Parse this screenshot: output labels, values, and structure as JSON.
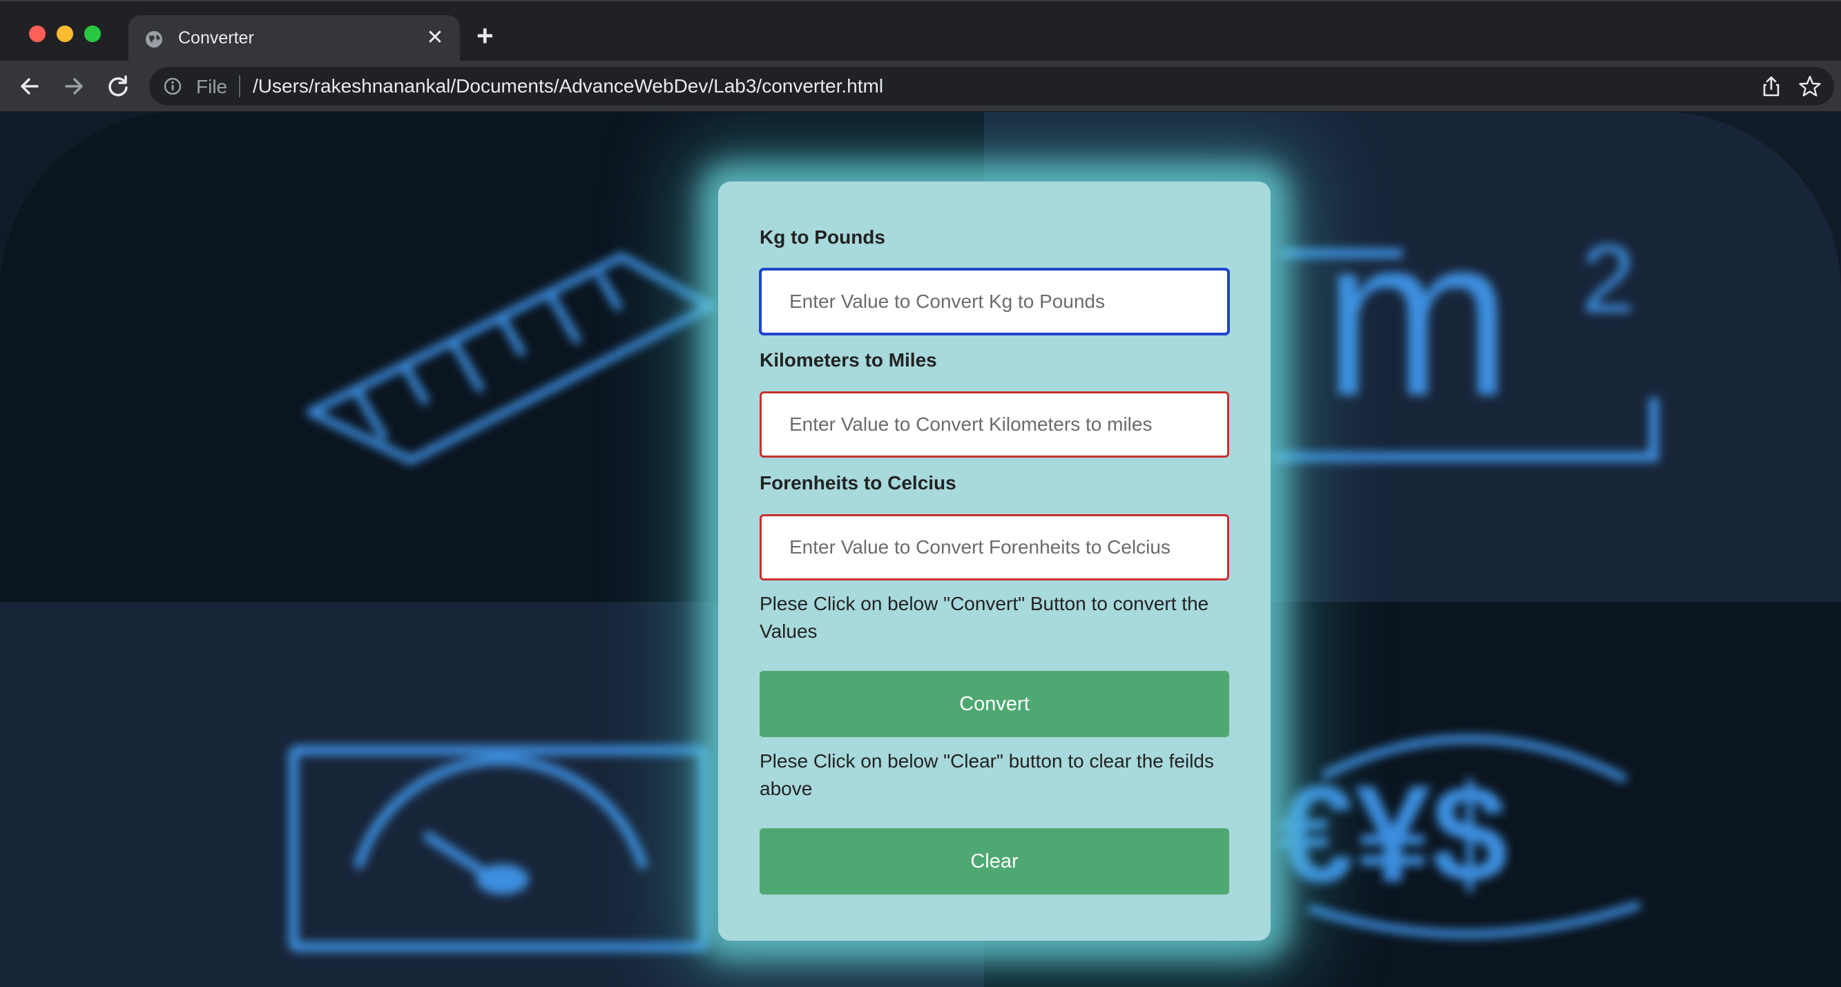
{
  "browser": {
    "tab_title": "Converter",
    "tab_close_glyph": "✕",
    "new_tab_glyph": "+",
    "omnibox": {
      "scheme_label": "File",
      "url": "/Users/rakeshnanankal/Documents/AdvanceWebDev/Lab3/converter.html"
    },
    "icons": [
      "globe-icon",
      "back-arrow-icon",
      "forward-arrow-icon",
      "reload-icon",
      "info-icon",
      "share-icon",
      "star-icon"
    ]
  },
  "converter": {
    "fields": [
      {
        "label": "Kg to Pounds",
        "placeholder": "Enter Value to Convert Kg to Pounds",
        "value": ""
      },
      {
        "label": "Kilometers to Miles",
        "placeholder": "Enter Value to Convert Kilometers to miles",
        "value": ""
      },
      {
        "label": "Forenheits to Celcius",
        "placeholder": "Enter Value to Convert Forenheits to Celcius",
        "value": ""
      }
    ],
    "convert_instruction": "Plese Click on below \"Convert\" Button to convert the Values",
    "convert_label": "Convert",
    "clear_instruction": "Plese Click on below \"Clear\" button to clear the feilds above",
    "clear_label": "Clear"
  },
  "background": {
    "icons": [
      "ruler-icon",
      "square-meter-icon",
      "gauge-icon",
      "currency-icon"
    ],
    "unit_glyph": "m",
    "exponent_glyph": "2",
    "currency_glyphs": "€¥$"
  },
  "colors": {
    "card_bg": "#a8d9dc",
    "button_green": "#4fa872",
    "invalid_border": "#c62f2f",
    "focus_border": "#1f44c9",
    "icon_blue": "#3d8fe0"
  }
}
